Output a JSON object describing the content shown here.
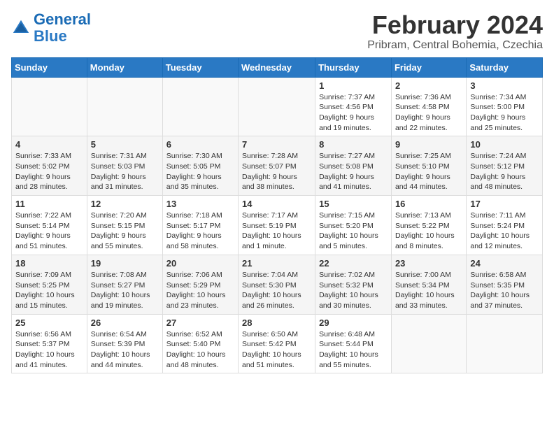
{
  "header": {
    "logo_line1": "General",
    "logo_line2": "Blue",
    "month": "February 2024",
    "location": "Pribram, Central Bohemia, Czechia"
  },
  "weekdays": [
    "Sunday",
    "Monday",
    "Tuesday",
    "Wednesday",
    "Thursday",
    "Friday",
    "Saturday"
  ],
  "weeks": [
    [
      {
        "day": "",
        "info": ""
      },
      {
        "day": "",
        "info": ""
      },
      {
        "day": "",
        "info": ""
      },
      {
        "day": "",
        "info": ""
      },
      {
        "day": "1",
        "info": "Sunrise: 7:37 AM\nSunset: 4:56 PM\nDaylight: 9 hours\nand 19 minutes."
      },
      {
        "day": "2",
        "info": "Sunrise: 7:36 AM\nSunset: 4:58 PM\nDaylight: 9 hours\nand 22 minutes."
      },
      {
        "day": "3",
        "info": "Sunrise: 7:34 AM\nSunset: 5:00 PM\nDaylight: 9 hours\nand 25 minutes."
      }
    ],
    [
      {
        "day": "4",
        "info": "Sunrise: 7:33 AM\nSunset: 5:02 PM\nDaylight: 9 hours\nand 28 minutes."
      },
      {
        "day": "5",
        "info": "Sunrise: 7:31 AM\nSunset: 5:03 PM\nDaylight: 9 hours\nand 31 minutes."
      },
      {
        "day": "6",
        "info": "Sunrise: 7:30 AM\nSunset: 5:05 PM\nDaylight: 9 hours\nand 35 minutes."
      },
      {
        "day": "7",
        "info": "Sunrise: 7:28 AM\nSunset: 5:07 PM\nDaylight: 9 hours\nand 38 minutes."
      },
      {
        "day": "8",
        "info": "Sunrise: 7:27 AM\nSunset: 5:08 PM\nDaylight: 9 hours\nand 41 minutes."
      },
      {
        "day": "9",
        "info": "Sunrise: 7:25 AM\nSunset: 5:10 PM\nDaylight: 9 hours\nand 44 minutes."
      },
      {
        "day": "10",
        "info": "Sunrise: 7:24 AM\nSunset: 5:12 PM\nDaylight: 9 hours\nand 48 minutes."
      }
    ],
    [
      {
        "day": "11",
        "info": "Sunrise: 7:22 AM\nSunset: 5:14 PM\nDaylight: 9 hours\nand 51 minutes."
      },
      {
        "day": "12",
        "info": "Sunrise: 7:20 AM\nSunset: 5:15 PM\nDaylight: 9 hours\nand 55 minutes."
      },
      {
        "day": "13",
        "info": "Sunrise: 7:18 AM\nSunset: 5:17 PM\nDaylight: 9 hours\nand 58 minutes."
      },
      {
        "day": "14",
        "info": "Sunrise: 7:17 AM\nSunset: 5:19 PM\nDaylight: 10 hours\nand 1 minute."
      },
      {
        "day": "15",
        "info": "Sunrise: 7:15 AM\nSunset: 5:20 PM\nDaylight: 10 hours\nand 5 minutes."
      },
      {
        "day": "16",
        "info": "Sunrise: 7:13 AM\nSunset: 5:22 PM\nDaylight: 10 hours\nand 8 minutes."
      },
      {
        "day": "17",
        "info": "Sunrise: 7:11 AM\nSunset: 5:24 PM\nDaylight: 10 hours\nand 12 minutes."
      }
    ],
    [
      {
        "day": "18",
        "info": "Sunrise: 7:09 AM\nSunset: 5:25 PM\nDaylight: 10 hours\nand 15 minutes."
      },
      {
        "day": "19",
        "info": "Sunrise: 7:08 AM\nSunset: 5:27 PM\nDaylight: 10 hours\nand 19 minutes."
      },
      {
        "day": "20",
        "info": "Sunrise: 7:06 AM\nSunset: 5:29 PM\nDaylight: 10 hours\nand 23 minutes."
      },
      {
        "day": "21",
        "info": "Sunrise: 7:04 AM\nSunset: 5:30 PM\nDaylight: 10 hours\nand 26 minutes."
      },
      {
        "day": "22",
        "info": "Sunrise: 7:02 AM\nSunset: 5:32 PM\nDaylight: 10 hours\nand 30 minutes."
      },
      {
        "day": "23",
        "info": "Sunrise: 7:00 AM\nSunset: 5:34 PM\nDaylight: 10 hours\nand 33 minutes."
      },
      {
        "day": "24",
        "info": "Sunrise: 6:58 AM\nSunset: 5:35 PM\nDaylight: 10 hours\nand 37 minutes."
      }
    ],
    [
      {
        "day": "25",
        "info": "Sunrise: 6:56 AM\nSunset: 5:37 PM\nDaylight: 10 hours\nand 41 minutes."
      },
      {
        "day": "26",
        "info": "Sunrise: 6:54 AM\nSunset: 5:39 PM\nDaylight: 10 hours\nand 44 minutes."
      },
      {
        "day": "27",
        "info": "Sunrise: 6:52 AM\nSunset: 5:40 PM\nDaylight: 10 hours\nand 48 minutes."
      },
      {
        "day": "28",
        "info": "Sunrise: 6:50 AM\nSunset: 5:42 PM\nDaylight: 10 hours\nand 51 minutes."
      },
      {
        "day": "29",
        "info": "Sunrise: 6:48 AM\nSunset: 5:44 PM\nDaylight: 10 hours\nand 55 minutes."
      },
      {
        "day": "",
        "info": ""
      },
      {
        "day": "",
        "info": ""
      }
    ]
  ]
}
